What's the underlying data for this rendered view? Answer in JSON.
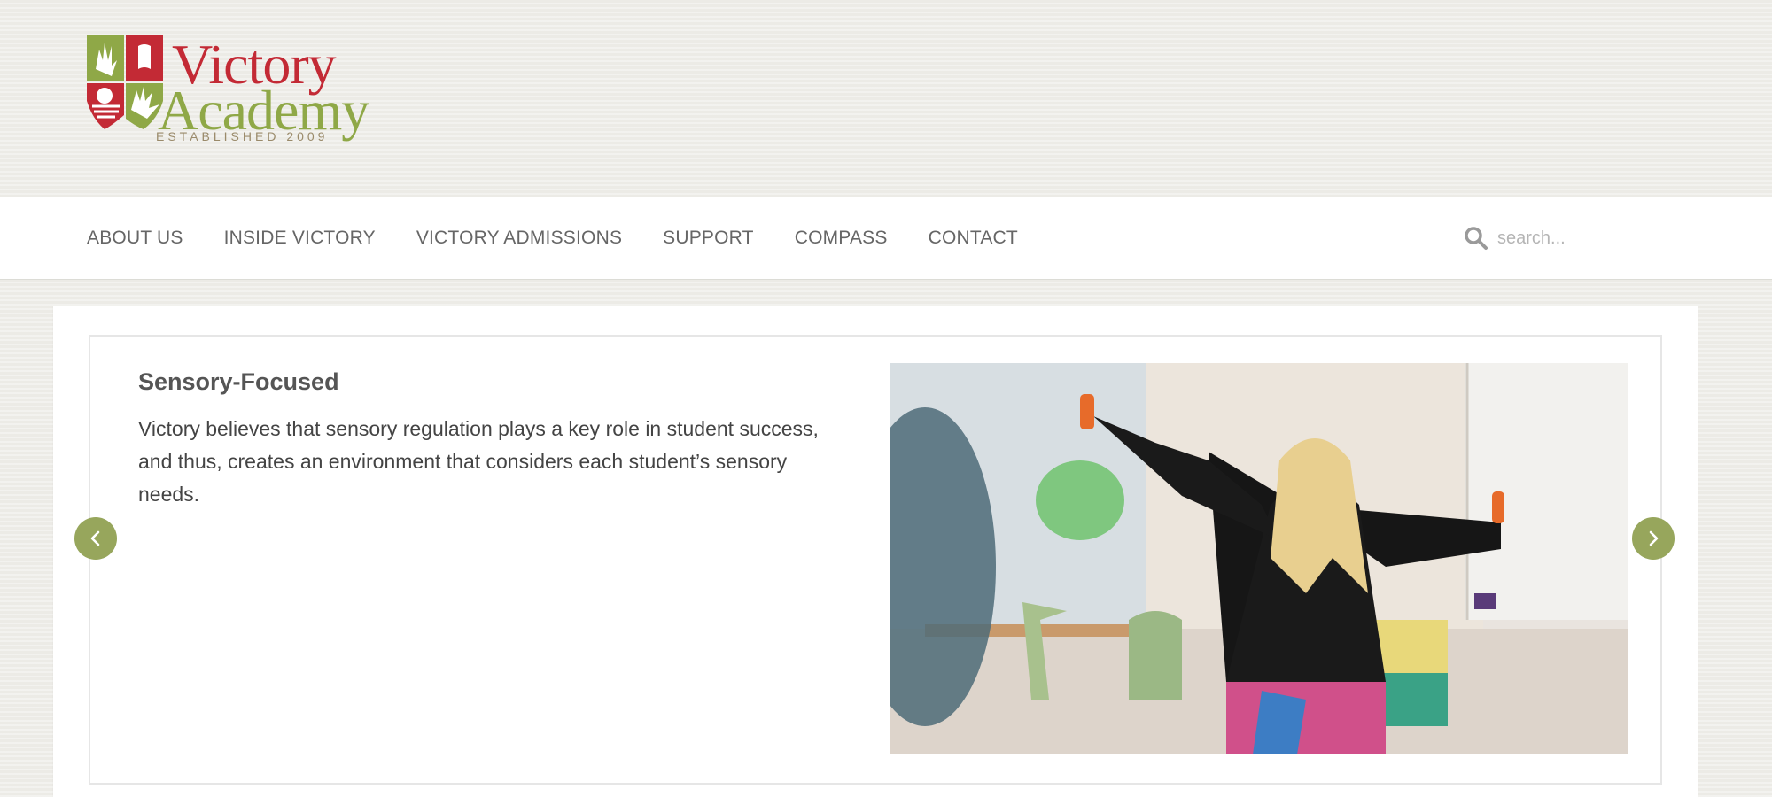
{
  "brand": {
    "name_line1": "Victory",
    "name_line2": "Academy",
    "established": "ESTABLISHED 2009",
    "colors": {
      "red": "#c32a35",
      "green": "#8fa847",
      "gold": "#9a8a6a"
    }
  },
  "nav": {
    "items": [
      {
        "label": "ABOUT US"
      },
      {
        "label": "INSIDE VICTORY"
      },
      {
        "label": "VICTORY ADMISSIONS"
      },
      {
        "label": "SUPPORT"
      },
      {
        "label": "COMPASS"
      },
      {
        "label": "CONTACT"
      }
    ]
  },
  "search": {
    "placeholder": "search...",
    "icon": "search-icon"
  },
  "slide": {
    "title": "Sensory-Focused",
    "text": "Victory believes that sensory regulation plays a key role in student success, and thus, creates an environment that considers each student’s sensory needs.",
    "image": "girl-with-sensory-tools-photo"
  },
  "controls": {
    "prev_icon": "chevron-left-icon",
    "next_icon": "chevron-right-icon",
    "accent": "#97a65c"
  }
}
